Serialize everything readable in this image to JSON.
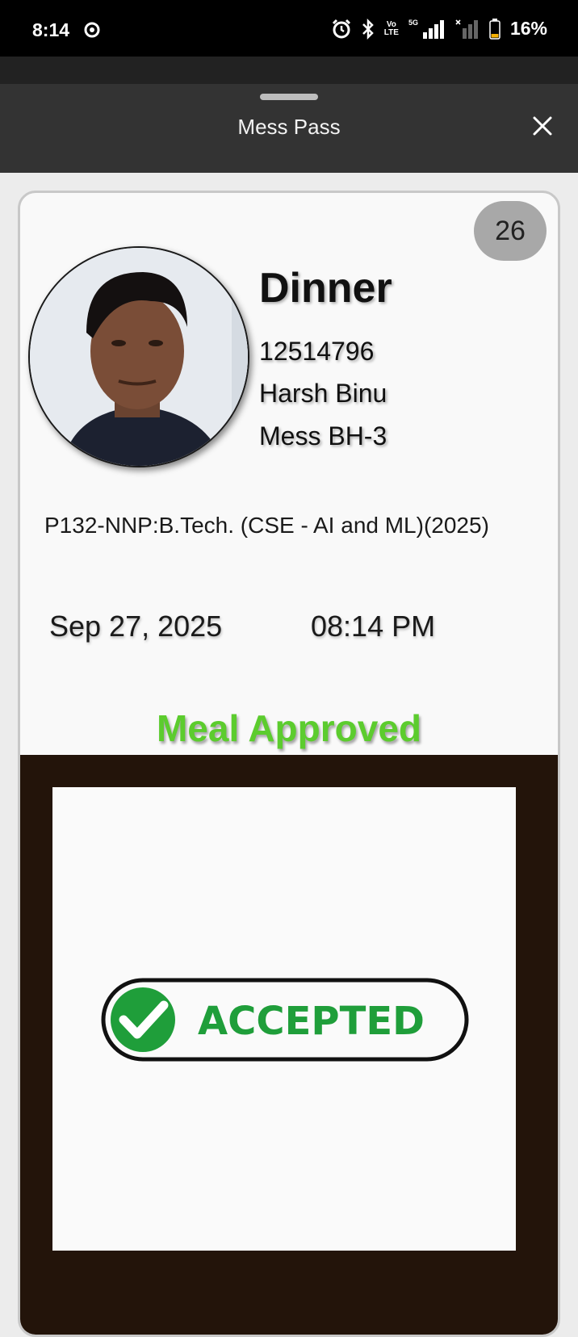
{
  "status_bar": {
    "time": "8:14",
    "volte_line1": "Vo",
    "volte_line2": "LTE",
    "network": "5G",
    "battery": "16%"
  },
  "sheet": {
    "title": "Mess Pass"
  },
  "pass": {
    "count": "26",
    "meal_type": "Dinner",
    "registration_no": "12514796",
    "student_name": "Harsh Binu",
    "mess": "Mess BH-3",
    "program": "P132-NNP:B.Tech. (CSE - AI and ML)(2025)",
    "date": "Sep 27, 2025",
    "time": "08:14 PM",
    "status": "Meal Approved",
    "stamp_text": "ACCEPTED"
  },
  "colors": {
    "approved_green": "#5ccc2e",
    "stamp_green": "#1f9e3a",
    "panel_dark": "#23140a",
    "header_bg": "#333333"
  },
  "icons": [
    "alarm-icon",
    "bluetooth-icon",
    "signal-icon",
    "battery-icon",
    "close-icon",
    "check-circle-icon"
  ]
}
